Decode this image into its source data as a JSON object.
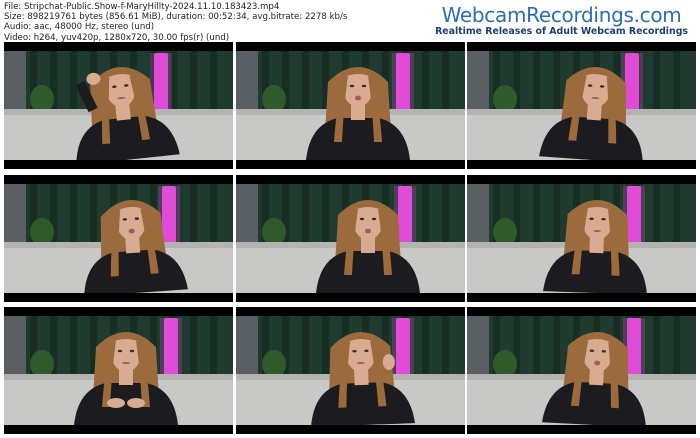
{
  "meta": {
    "file_line": "File: Stripchat-Public.Show-f-MaryHillty-2024.11.10.183423.mp4",
    "size_line": "Size: 898219761 bytes (856.61 MiB), duration: 00:52:34, avg.bitrate: 2278 kb/s",
    "audio_line": "Audio: aac, 48000 Hz, stereo (und)",
    "video_line": "Video: h264, yuv420p, 1280x720, 30.00 fps(r) (und)"
  },
  "brand": {
    "name": "WebcamRecordings.com",
    "tagline": "Realtime Releases of Adult Webcam Recordings"
  },
  "thumbnails": [
    {
      "pose": "hand-on-head"
    },
    {
      "pose": "talking"
    },
    {
      "pose": "looking-down"
    },
    {
      "pose": "talking"
    },
    {
      "pose": "surprised"
    },
    {
      "pose": "looking-down"
    },
    {
      "pose": "hands-together"
    },
    {
      "pose": "hand-near-face"
    },
    {
      "pose": "talking"
    }
  ],
  "colors": {
    "curtain": "#1f3b30",
    "curtain_dark": "#12241c",
    "pink_light": "#e04bd8",
    "sofa": "#c8c9c6",
    "wall": "#5a5f63",
    "hair": "#9b6a3d",
    "skin": "#d9ab91",
    "top": "#1c1c20"
  }
}
